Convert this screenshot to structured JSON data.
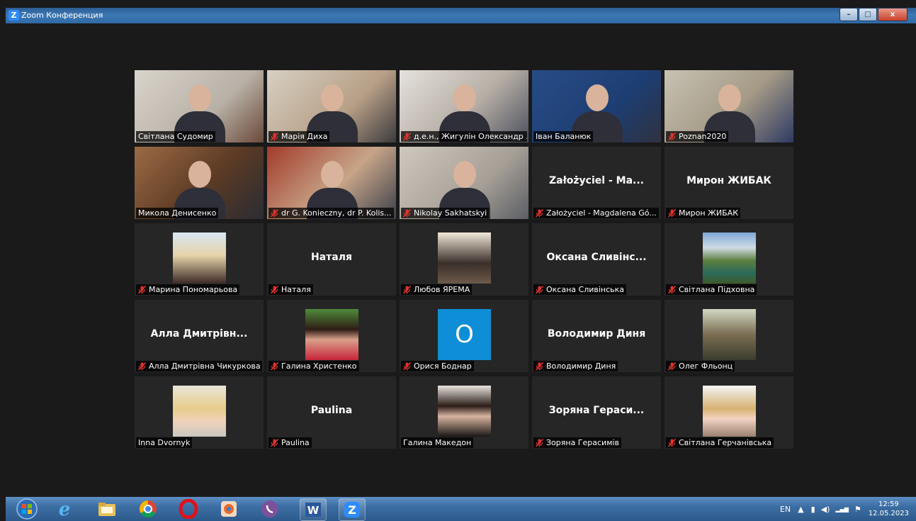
{
  "window": {
    "title": "Zoom Конференция",
    "app_logo": "Z",
    "minimize": "–",
    "maximize": "□",
    "close": "x"
  },
  "participants": [
    {
      "name": "Світлана Судомир",
      "muted": false,
      "mode": "video"
    },
    {
      "name": "Марія Диха",
      "muted": true,
      "mode": "video"
    },
    {
      "name": "д.е.н., Жигулін Олександр ...",
      "muted": true,
      "mode": "video"
    },
    {
      "name": "Іван Баланюк",
      "muted": false,
      "mode": "video",
      "active": true
    },
    {
      "name": "Poznan2020",
      "muted": true,
      "mode": "video"
    },
    {
      "name": "Микола Денисенко",
      "muted": false,
      "mode": "video"
    },
    {
      "name": "dr G. Konieczny, dr P. Kolis...",
      "muted": true,
      "mode": "video"
    },
    {
      "name": "Nikolay Sakhatskyi",
      "muted": true,
      "mode": "video"
    },
    {
      "name": "Założyciel - Magdalena Gó...",
      "display": "Założyciel - Ma...",
      "muted": true,
      "mode": "text"
    },
    {
      "name": "Мирон ЖИБАК",
      "display": "Мирон ЖИБАК",
      "muted": true,
      "mode": "text"
    },
    {
      "name": "Марина Пономарьова",
      "muted": true,
      "mode": "avatar"
    },
    {
      "name": "Наталя",
      "display": "Наталя",
      "muted": true,
      "mode": "text"
    },
    {
      "name": "Любов ЯРЕМА",
      "muted": true,
      "mode": "avatar"
    },
    {
      "name": "Оксана Сливінська",
      "display": "Оксана Сливінс...",
      "muted": true,
      "mode": "text"
    },
    {
      "name": "Світлана Підховна",
      "muted": true,
      "mode": "avatar"
    },
    {
      "name": "Алла Дмитрівна Чикуркова",
      "display": "Алла Дмитрівн...",
      "muted": true,
      "mode": "text"
    },
    {
      "name": "Галина Христенко",
      "muted": true,
      "mode": "avatar"
    },
    {
      "name": "Орися Боднар",
      "muted": true,
      "mode": "letter",
      "letter": "O"
    },
    {
      "name": "Володимир Диня",
      "display": "Володимир Диня",
      "muted": true,
      "mode": "text"
    },
    {
      "name": "Олег Фльонц",
      "muted": true,
      "mode": "avatar"
    },
    {
      "name": "Inna Dvornyk",
      "muted": false,
      "mode": "avatar"
    },
    {
      "name": "Paulina",
      "display": "Paulina",
      "muted": true,
      "mode": "text"
    },
    {
      "name": "Галина Македон",
      "muted": false,
      "mode": "avatar"
    },
    {
      "name": "Зоряна Герасимів",
      "display": "Зоряна Гераси...",
      "muted": true,
      "mode": "text"
    },
    {
      "name": "Світлана Герчанівська",
      "muted": true,
      "mode": "avatar"
    }
  ],
  "taskbar": {
    "icons": [
      "start-orb-icon",
      "internet-explorer-icon",
      "file-explorer-icon",
      "chrome-icon",
      "opera-icon",
      "settings-app-icon",
      "viber-icon",
      "word-icon",
      "zoom-icon"
    ],
    "language": "EN",
    "time": "12:59",
    "date": "12.05.2023"
  },
  "colors": {
    "active_speaker": "#c6e36a",
    "muted_mic": "#e0342c",
    "zoom_blue": "#2d8cff"
  }
}
